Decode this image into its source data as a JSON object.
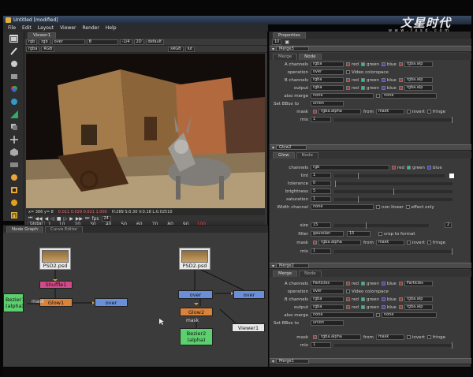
{
  "app": {
    "title": "Untitled [modified]"
  },
  "watermark": {
    "title": "文星时代",
    "url": "w w w . f x s d . c o m"
  },
  "menu": [
    "File",
    "Edit",
    "Layout",
    "Viewer",
    "Render",
    "Help"
  ],
  "viewer": {
    "tab": "Viewer1",
    "toolbar": [
      "rgb",
      "rgb",
      "over",
      "B",
      "-1/4",
      "2D",
      "default"
    ],
    "toolbar2": [
      "rgba",
      "RGB",
      "sRGB",
      "lut"
    ],
    "status": {
      "coords": "x= 386 y= 8",
      "values": "0.011  0.029  0.021  1.000",
      "hsv": "H:289 S:0.30 V:0.18 L:0.02510"
    },
    "timeline": {
      "global": "Global",
      "fps_label": "fps",
      "fps": "24",
      "ticks": [
        "1",
        "10",
        "20",
        "30",
        "40",
        "50",
        "60",
        "70",
        "80",
        "90",
        "100"
      ]
    }
  },
  "graph": {
    "tabs": [
      "Node Graph",
      "Curve Editor"
    ],
    "nodes": {
      "psd_left": "PSD2.psd",
      "psd_right": "PSD2.psd",
      "shuffle": "Shuffle1",
      "glow1": "Glow1",
      "over_left": "over",
      "bezier_left": "Bezier1\n(alpha)",
      "bezier_left_l1": "Bezier1",
      "bezier_left_l2": "(alpha)",
      "over_r1": "over",
      "over_r2": "over",
      "glow2": "Glow2",
      "bezier2_l1": "Bezier2",
      "bezier2_l2": "(alpha)",
      "viewer1": "Viewer1"
    },
    "edge_labels": {
      "mask1": "mask",
      "mask2": "mask"
    }
  },
  "properties": {
    "title": "Properties",
    "counter": "10",
    "merge3": {
      "name": "Merge3",
      "tabs": [
        "Merge",
        "Node"
      ],
      "a_channels": {
        "label": "A channels",
        "value": "rgba",
        "chans": [
          "red",
          "green",
          "blue"
        ],
        "extra": "rgba.alp"
      },
      "operation": {
        "label": "operation",
        "value": "over",
        "opt": "Video colorspace"
      },
      "b_channels": {
        "label": "B channels",
        "value": "rgba",
        "chans": [
          "red",
          "green",
          "blue"
        ],
        "extra": "rgba.alp"
      },
      "output": {
        "label": "output",
        "value": "rgba",
        "chans": [
          "red",
          "green",
          "blue"
        ],
        "extra": "rgba.alp"
      },
      "also_merge": {
        "label": "also merge",
        "value": "none",
        "value2": "none"
      },
      "set_bbox": {
        "label": "Set BBox to",
        "value": "union"
      },
      "mask": {
        "label": "mask",
        "value": "rgba.alpha",
        "from": "from",
        "from_val": "mask",
        "invert": "invert",
        "fringe": "fringe"
      },
      "mix": {
        "label": "mix",
        "value": "1"
      }
    },
    "glow2": {
      "name": "Glow2",
      "tabs": [
        "Glow",
        "Node"
      ],
      "channels": {
        "label": "channels",
        "value": "rgb",
        "chans": [
          "red",
          "green",
          "blue"
        ]
      },
      "tint": {
        "label": "tint",
        "value": "1"
      },
      "tolerance": {
        "label": "tolerance",
        "value": "0"
      },
      "brightness": {
        "label": "brightness",
        "value": "5"
      },
      "saturation": {
        "label": "saturation",
        "value": "1"
      },
      "width_channel": {
        "label": "Width channel",
        "value": "none",
        "opt1": "non linear",
        "opt2": "effect only"
      },
      "size": {
        "label": "size",
        "value": "15",
        "value2": "2"
      },
      "filter": {
        "label": "filter",
        "value": "gaussian",
        "value2": "15",
        "opt": "crop to format"
      },
      "mask": {
        "label": "mask",
        "value": "rgba.alpha",
        "from": "from",
        "from_val": "mask",
        "invert": "invert",
        "fringe": "fringe"
      },
      "mix": {
        "label": "mix",
        "value": "1"
      }
    },
    "merge2": {
      "name": "Merge2",
      "tabs": [
        "Merge",
        "Node"
      ],
      "a_channels": {
        "label": "A channels",
        "value": "Particles",
        "chans": [
          "red",
          "green",
          "blue"
        ],
        "extra": "Particles"
      },
      "operation": {
        "label": "operation",
        "value": "over",
        "opt": "Video colorspace"
      },
      "b_channels": {
        "label": "B channels",
        "value": "rgba",
        "chans": [
          "red",
          "green",
          "blue"
        ],
        "extra": "rgba.alp"
      },
      "output": {
        "label": "output",
        "value": "rgba",
        "chans": [
          "red",
          "green",
          "blue"
        ],
        "extra": "rgba.alp"
      },
      "also_merge": {
        "label": "also merge",
        "value": "none",
        "value2": "none"
      },
      "set_bbox": {
        "label": "Set BBox to",
        "value": "union"
      },
      "mask": {
        "label": "mask",
        "value": "rgba.alpha",
        "from": "from",
        "from_val": "mask",
        "invert": "invert",
        "fringe": "fringe"
      },
      "mix": {
        "label": "mix",
        "value": "1"
      }
    },
    "merge1": {
      "name": "Merge1"
    }
  },
  "colors": {
    "accent": "#e0b03a",
    "node_orange": "#d9823a",
    "node_blue": "#6a8fd8",
    "node_green": "#5ccf6e",
    "node_pink": "#d24a8a"
  }
}
